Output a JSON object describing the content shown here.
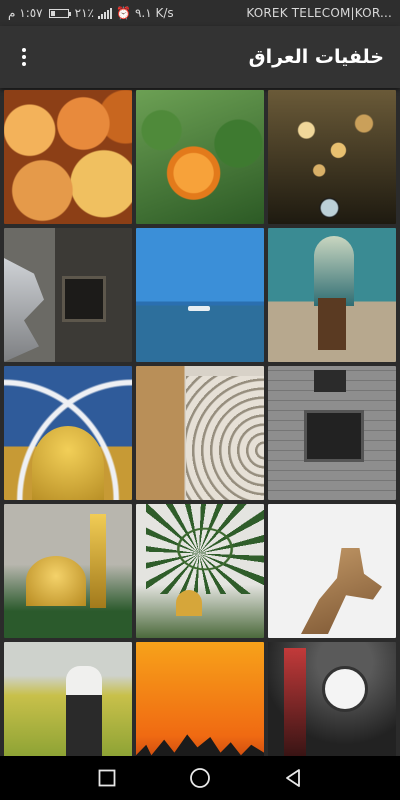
{
  "status_bar": {
    "time": "١:٥٧ م",
    "battery": "٢١٪",
    "speed": "٩.١ K/s",
    "carrier": "KOREK TELECOM|KOR..."
  },
  "app_bar": {
    "title": "خلفيات العراق",
    "menu_icon": "more-vert-icon"
  },
  "grid": {
    "tiles": [
      {
        "subject": "peaches"
      },
      {
        "subject": "orange-rose"
      },
      {
        "subject": "golden-bokeh"
      },
      {
        "subject": "old-brick-wall"
      },
      {
        "subject": "river-sea"
      },
      {
        "subject": "mosque-interior-tiles"
      },
      {
        "subject": "golden-dome-arches"
      },
      {
        "subject": "carved-stone-arch"
      },
      {
        "subject": "stone-house-window"
      },
      {
        "subject": "golden-shrine"
      },
      {
        "subject": "palm-tree-dome"
      },
      {
        "subject": "camel"
      },
      {
        "subject": "farmer-in-field"
      },
      {
        "subject": "sunset-silhouettes"
      },
      {
        "subject": "crowd-clock-tower"
      }
    ]
  },
  "nav_bar": {
    "recents_icon": "square-icon",
    "home_icon": "circle-icon",
    "back_icon": "triangle-back-icon"
  }
}
